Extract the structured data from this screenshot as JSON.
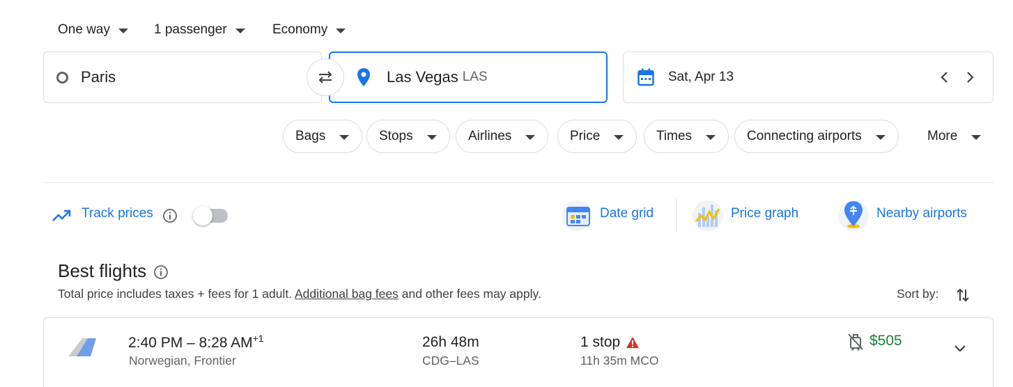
{
  "top_selectors": {
    "trip_type": "One way",
    "passengers": "1 passenger",
    "cabin": "Economy"
  },
  "search": {
    "origin": "Paris",
    "destination": "Las Vegas",
    "destination_code": "LAS",
    "date": "Sat, Apr 13"
  },
  "filters": {
    "bags": "Bags",
    "stops": "Stops",
    "airlines": "Airlines",
    "price": "Price",
    "times": "Times",
    "connecting": "Connecting airports",
    "more": "More"
  },
  "tools": {
    "track_prices": "Track prices",
    "date_grid": "Date grid",
    "price_graph": "Price graph",
    "nearby_airports": "Nearby airports"
  },
  "best_flights": {
    "title": "Best flights",
    "note_before": "Total price includes taxes + fees for 1 adult. ",
    "note_link": "Additional bag fees",
    "note_after": " and other fees may apply.",
    "sort_by": "Sort by:"
  },
  "flight": {
    "time_range": "2:40 PM – 8:28 AM",
    "day_offset": "+1",
    "airlines": "Norwegian, Frontier",
    "duration": "26h 48m",
    "route": "CDG–LAS",
    "stops": "1 stop",
    "layover": "11h 35m MCO",
    "price": "$505"
  },
  "colors": {
    "accent": "#1a73e8",
    "price_green": "#188038",
    "warning_red": "#d93025"
  }
}
